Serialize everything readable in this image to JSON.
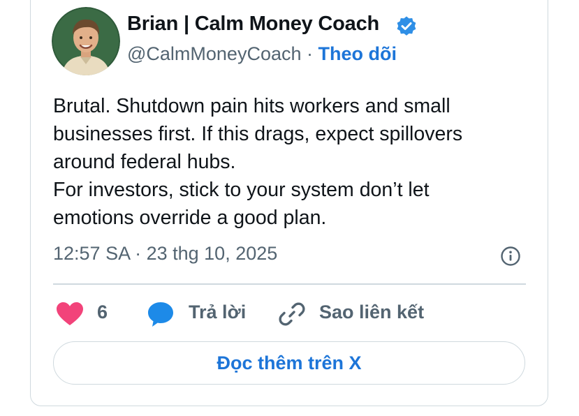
{
  "author": {
    "name": "Brian | Calm Money Coach",
    "handle": "@CalmMoneyCoach",
    "separator": "·",
    "follow_label": "Theo dõi",
    "avatar_icon": "avatar-illustration",
    "verified_icon": "verified-badge-icon",
    "verified_color": "#2f8fe6"
  },
  "tweet": {
    "lines": [
      "Brutal. Shutdown pain hits workers and small",
      "businesses first. If this drags, expect spillovers",
      "around federal hubs.",
      "For investors, stick to your system don’t let",
      "emotions override a good plan."
    ],
    "timestamp": "12:57 SA · 23 thg 10, 2025",
    "info_icon": "info-icon"
  },
  "actions": {
    "like_icon": "heart-icon",
    "like_color": "#f2437a",
    "like_count": "6",
    "reply_icon": "speech-bubble-icon",
    "reply_color": "#1d8ae8",
    "reply_label": "Trả lời",
    "copy_link_icon": "link-icon",
    "copy_link_label": "Sao liên kết"
  },
  "read_more": {
    "label": "Đọc thêm trên X",
    "color": "#1d75d8"
  }
}
